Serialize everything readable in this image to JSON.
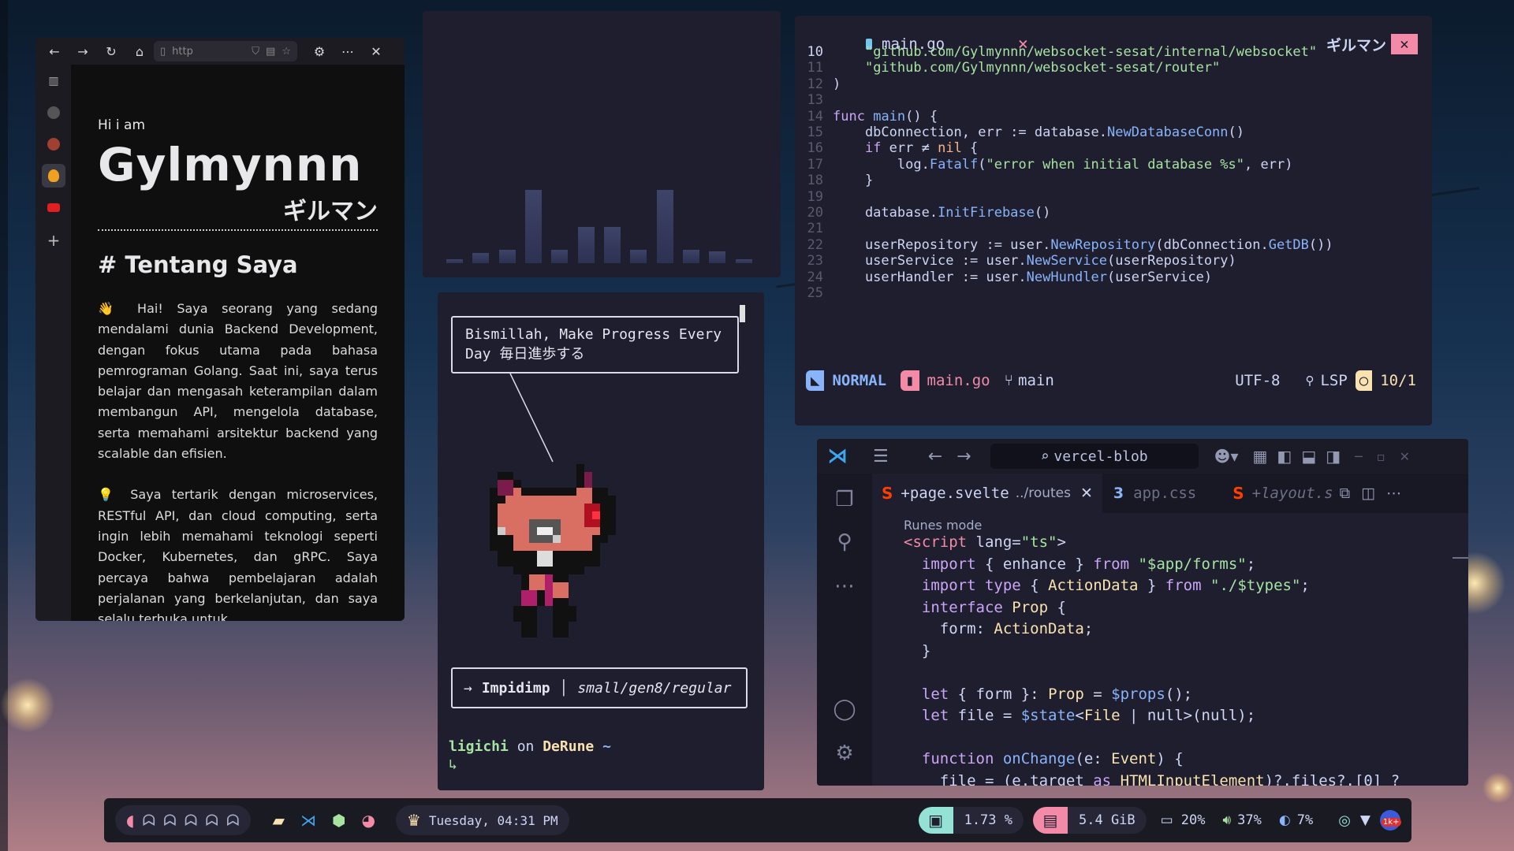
{
  "browser": {
    "url_snippet": "http",
    "greeting": "Hi i am",
    "name": "Gylmynnn",
    "name_jp": "ギルマン",
    "heading": "# Tentang Saya",
    "para1_icon": "👋",
    "para1": "Hai! Saya seorang yang sedang mendalami dunia Backend Development, dengan fokus utama pada bahasa pemrograman Golang. Saat ini, saya terus belajar dan mengasah keterampilan dalam membangun API, mengelola database, serta memahami arsitektur backend yang scalable dan efisien.",
    "para2_icon": "💡",
    "para2": "Saya tertarik dengan microservices, RESTful API, dan cloud computing, serta ingin lebih memahami teknologi seperti Docker, Kubernetes, dan gRPC. Saya percaya bahwa pembelajaran adalah perjalanan yang berkelanjutan, dan saya selalu terbuka untuk"
  },
  "cava": {
    "levels": [
      0.05,
      0.14,
      0.18,
      0.98,
      0.18,
      0.48,
      0.48,
      0.18,
      0.98,
      0.18,
      0.16,
      0.05
    ]
  },
  "poke": {
    "quote": "Bismillah, Make Progress Every Day 毎日進歩する",
    "arrow": "→",
    "pokemon": "Impidimp",
    "sep": "│",
    "variant": "small/gen8/regular",
    "prompt_user": "ligichi",
    "prompt_on": " on ",
    "prompt_host": "DeRune",
    "prompt_tilde": " ~",
    "prompt_arrow": "↳"
  },
  "nvim": {
    "tab_file": "main.go",
    "tab_close": "×",
    "tab_right": "ギルマン",
    "lines": [
      {
        "n": "10",
        "t": "    \"github.com/Gylmynnn/websocket-sesat/internal/websocket\""
      },
      {
        "n": "11",
        "t": "    \"github.com/Gylmynnn/websocket-sesat/router\""
      },
      {
        "n": "12",
        "t": ")"
      },
      {
        "n": "13",
        "t": ""
      },
      {
        "n": "14",
        "t": "func main() {"
      },
      {
        "n": "15",
        "t": "    dbConnection, err := database.NewDatabaseConn()"
      },
      {
        "n": "16",
        "t": "    if err ≠ nil {"
      },
      {
        "n": "17",
        "t": "        log.Fatalf(\"error when initial database %s\", err)"
      },
      {
        "n": "18",
        "t": "    }"
      },
      {
        "n": "19",
        "t": ""
      },
      {
        "n": "20",
        "t": "    database.InitFirebase()"
      },
      {
        "n": "21",
        "t": ""
      },
      {
        "n": "22",
        "t": "    userRepository := user.NewRepository(dbConnection.GetDB())"
      },
      {
        "n": "23",
        "t": "    userService := user.NewService(userRepository)"
      },
      {
        "n": "24",
        "t": "    userHandler := user.NewHundler(userService)"
      },
      {
        "n": "25",
        "t": ""
      }
    ],
    "mode": "NORMAL",
    "file": "main.go",
    "branch": "main",
    "encoding": "UTF-8",
    "lsp": "LSP",
    "position": "10/1"
  },
  "vscode": {
    "search": "vercel-blob",
    "tab1": "+page.svelte",
    "tab1_path": "../routes",
    "tab2": "app.css",
    "tab3": "+layout.s",
    "hint": "Runes mode",
    "code": [
      "<script lang=\"ts\">",
      "  import { enhance } from \"$app/forms\";",
      "  import type { ActionData } from \"./$types\";",
      "  interface Prop {",
      "    form: ActionData;",
      "  }",
      "",
      "  let { form }: Prop = $props();",
      "  let file = $state<File | null>(null);",
      "",
      "  function onChange(e: Event) {",
      "    file = (e.target as HTMLInputElement)?.files?.[0] ?"
    ]
  },
  "taskbar": {
    "datetime": "Tuesday, 04:31 PM",
    "cpu": "1.73 %",
    "mem": "5.4 GiB",
    "battery": "20%",
    "volume": "37%",
    "brightness": "7%",
    "notif": "1k+"
  }
}
